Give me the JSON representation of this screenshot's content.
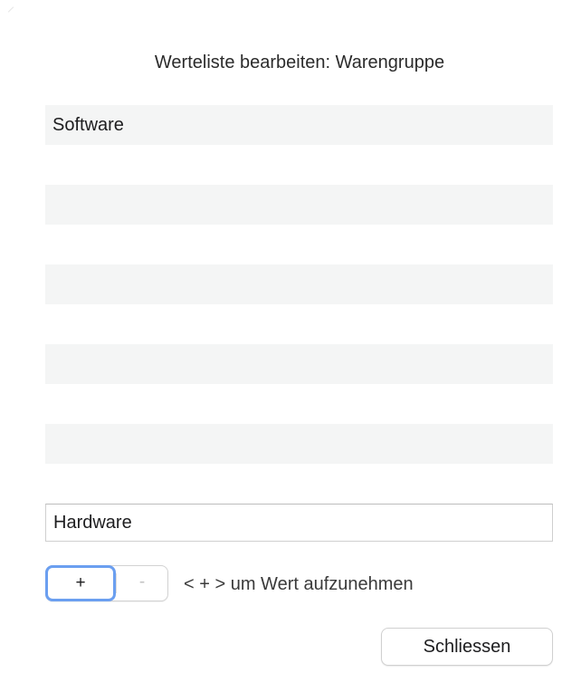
{
  "dialog": {
    "title": "Werteliste bearbeiten: Warengruppe",
    "list": {
      "rows": [
        "Software",
        "",
        "",
        "",
        "",
        "",
        "",
        "",
        "",
        ""
      ]
    },
    "input": {
      "value": "Hardware"
    },
    "add_button_label": "+",
    "remove_button_label": "-",
    "hint": "< + > um Wert aufzunehmen",
    "close_button_label": "Schliessen"
  },
  "colors": {
    "stripe": "#f4f5f5",
    "focus_ring": "#6b9ff0",
    "disabled_text": "#c2c2c2"
  }
}
